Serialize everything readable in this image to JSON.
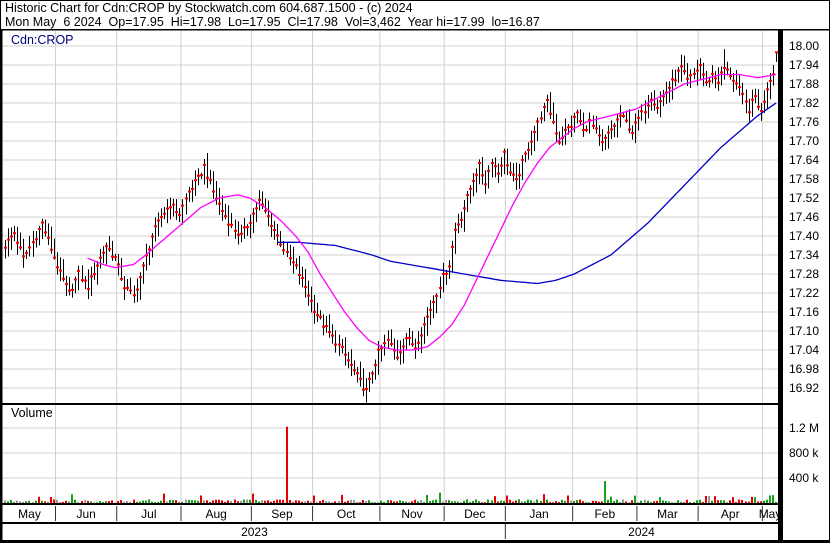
{
  "header": {
    "line1": "Historic Chart for Cdn:CROP by Stockwatch.com 604.687.1500 - (c) 2024",
    "line2": "Mon May  6 2024  Op=17.95  Hi=17.98  Lo=17.95  Cl=17.98  Vol=3,462  Year hi=17.99  lo=16.87"
  },
  "chart_data": {
    "type": "ohlc-with-volume",
    "symbol_label": "Cdn:CROP",
    "volume_label": "Volume",
    "quote": {
      "date": "Mon May 6 2024",
      "open": 17.95,
      "high": 17.98,
      "low": 17.95,
      "close": 17.98,
      "volume": 3462,
      "year_high": 17.99,
      "year_low": 16.87
    },
    "num_days": 253,
    "price_axis": {
      "ticks": [
        {
          "label": "18.00",
          "value": 18.0
        },
        {
          "label": "17.94",
          "value": 17.94
        },
        {
          "label": "17.88",
          "value": 17.88
        },
        {
          "label": "17.82",
          "value": 17.82
        },
        {
          "label": "17.76",
          "value": 17.76
        },
        {
          "label": "17.70",
          "value": 17.7
        },
        {
          "label": "17.64",
          "value": 17.64
        },
        {
          "label": "17.58",
          "value": 17.58
        },
        {
          "label": "17.52",
          "value": 17.52
        },
        {
          "label": "17.46",
          "value": 17.46
        },
        {
          "label": "17.40",
          "value": 17.4
        },
        {
          "label": "17.34",
          "value": 17.34
        },
        {
          "label": "17.28",
          "value": 17.28
        },
        {
          "label": "17.22",
          "value": 17.22
        },
        {
          "label": "17.16",
          "value": 17.16
        },
        {
          "label": "17.10",
          "value": 17.1
        },
        {
          "label": "17.04",
          "value": 17.04
        },
        {
          "label": "16.98",
          "value": 16.98
        },
        {
          "label": "16.92",
          "value": 16.92
        }
      ]
    },
    "volume_axis": {
      "ticks": [
        {
          "label": "1.2 M",
          "value": 1200000
        },
        {
          "label": "800 k",
          "value": 800000
        },
        {
          "label": "400 k",
          "value": 400000
        }
      ]
    },
    "months": [
      {
        "label": "May",
        "start": 0
      },
      {
        "label": "Jun",
        "start": 17
      },
      {
        "label": "Jul",
        "start": 37
      },
      {
        "label": "Aug",
        "start": 58
      },
      {
        "label": "Sep",
        "start": 81
      },
      {
        "label": "Oct",
        "start": 101
      },
      {
        "label": "Nov",
        "start": 123
      },
      {
        "label": "Dec",
        "start": 144
      },
      {
        "label": "Jan",
        "start": 164
      },
      {
        "label": "Feb",
        "start": 186
      },
      {
        "label": "Mar",
        "start": 207
      },
      {
        "label": "Apr",
        "start": 227
      },
      {
        "label": "May",
        "start": 248
      }
    ],
    "years": [
      {
        "label": "2023",
        "start": 0,
        "end": 164
      },
      {
        "label": "2024",
        "start": 164,
        "end": 253
      }
    ],
    "close_keyframes": [
      [
        0,
        17.37
      ],
      [
        3,
        17.41
      ],
      [
        6,
        17.33
      ],
      [
        9,
        17.38
      ],
      [
        12,
        17.44
      ],
      [
        15,
        17.36
      ],
      [
        18,
        17.28
      ],
      [
        21,
        17.22
      ],
      [
        24,
        17.28
      ],
      [
        27,
        17.24
      ],
      [
        30,
        17.31
      ],
      [
        33,
        17.37
      ],
      [
        36,
        17.33
      ],
      [
        39,
        17.24
      ],
      [
        42,
        17.21
      ],
      [
        45,
        17.3
      ],
      [
        48,
        17.4
      ],
      [
        51,
        17.46
      ],
      [
        54,
        17.5
      ],
      [
        57,
        17.47
      ],
      [
        60,
        17.54
      ],
      [
        63,
        17.58
      ],
      [
        65,
        17.62
      ],
      [
        68,
        17.54
      ],
      [
        71,
        17.48
      ],
      [
        74,
        17.43
      ],
      [
        77,
        17.4
      ],
      [
        80,
        17.45
      ],
      [
        83,
        17.51
      ],
      [
        86,
        17.46
      ],
      [
        89,
        17.4
      ],
      [
        92,
        17.34
      ],
      [
        95,
        17.3
      ],
      [
        98,
        17.24
      ],
      [
        101,
        17.17
      ],
      [
        104,
        17.12
      ],
      [
        107,
        17.08
      ],
      [
        110,
        17.04
      ],
      [
        113,
        16.99
      ],
      [
        116,
        16.94
      ],
      [
        118,
        16.91
      ],
      [
        120,
        16.97
      ],
      [
        122,
        17.03
      ],
      [
        125,
        17.07
      ],
      [
        128,
        17.02
      ],
      [
        131,
        17.08
      ],
      [
        134,
        17.05
      ],
      [
        137,
        17.12
      ],
      [
        139,
        17.17
      ],
      [
        141,
        17.22
      ],
      [
        143,
        17.27
      ],
      [
        145,
        17.31
      ],
      [
        147,
        17.42
      ],
      [
        149,
        17.46
      ],
      [
        151,
        17.52
      ],
      [
        153,
        17.58
      ],
      [
        155,
        17.62
      ],
      [
        157,
        17.57
      ],
      [
        159,
        17.64
      ],
      [
        161,
        17.6
      ],
      [
        163,
        17.66
      ],
      [
        165,
        17.6
      ],
      [
        167,
        17.57
      ],
      [
        169,
        17.63
      ],
      [
        171,
        17.68
      ],
      [
        173,
        17.73
      ],
      [
        175,
        17.78
      ],
      [
        177,
        17.82
      ],
      [
        179,
        17.76
      ],
      [
        181,
        17.7
      ],
      [
        183,
        17.73
      ],
      [
        185,
        17.75
      ],
      [
        187,
        17.79
      ],
      [
        189,
        17.73
      ],
      [
        191,
        17.76
      ],
      [
        193,
        17.73
      ],
      [
        195,
        17.69
      ],
      [
        197,
        17.72
      ],
      [
        199,
        17.75
      ],
      [
        201,
        17.78
      ],
      [
        203,
        17.76
      ],
      [
        205,
        17.73
      ],
      [
        207,
        17.77
      ],
      [
        209,
        17.8
      ],
      [
        211,
        17.84
      ],
      [
        213,
        17.81
      ],
      [
        215,
        17.84
      ],
      [
        217,
        17.87
      ],
      [
        219,
        17.9
      ],
      [
        221,
        17.93
      ],
      [
        223,
        17.89
      ],
      [
        225,
        17.91
      ],
      [
        227,
        17.94
      ],
      [
        229,
        17.88
      ],
      [
        231,
        17.91
      ],
      [
        233,
        17.89
      ],
      [
        235,
        17.93
      ],
      [
        237,
        17.91
      ],
      [
        239,
        17.88
      ],
      [
        241,
        17.84
      ],
      [
        243,
        17.8
      ],
      [
        245,
        17.84
      ],
      [
        247,
        17.79
      ],
      [
        249,
        17.87
      ],
      [
        251,
        17.92
      ],
      [
        252,
        17.98
      ]
    ],
    "bar_overrides": {
      "118": {
        "low": 16.87
      },
      "235": {
        "high": 17.99
      },
      "252": {
        "high": 17.98,
        "low": 17.95,
        "close": 17.98
      }
    },
    "ma_fast": {
      "name": "short-moving-average",
      "color": "#ff00ff",
      "points": [
        [
          27,
          17.33
        ],
        [
          32,
          17.31
        ],
        [
          36,
          17.3
        ],
        [
          42,
          17.31
        ],
        [
          46,
          17.34
        ],
        [
          52,
          17.39
        ],
        [
          58,
          17.44
        ],
        [
          64,
          17.49
        ],
        [
          70,
          17.52
        ],
        [
          76,
          17.53
        ],
        [
          80,
          17.52
        ],
        [
          85,
          17.49
        ],
        [
          90,
          17.45
        ],
        [
          95,
          17.4
        ],
        [
          99,
          17.35
        ],
        [
          103,
          17.28
        ],
        [
          107,
          17.22
        ],
        [
          111,
          17.16
        ],
        [
          115,
          17.11
        ],
        [
          119,
          17.07
        ],
        [
          123,
          17.05
        ],
        [
          128,
          17.04
        ],
        [
          133,
          17.04
        ],
        [
          138,
          17.05
        ],
        [
          142,
          17.08
        ],
        [
          146,
          17.12
        ],
        [
          150,
          17.18
        ],
        [
          154,
          17.26
        ],
        [
          158,
          17.34
        ],
        [
          162,
          17.42
        ],
        [
          166,
          17.5
        ],
        [
          170,
          17.57
        ],
        [
          174,
          17.63
        ],
        [
          178,
          17.68
        ],
        [
          182,
          17.71
        ],
        [
          186,
          17.74
        ],
        [
          190,
          17.76
        ],
        [
          194,
          17.77
        ],
        [
          198,
          17.78
        ],
        [
          202,
          17.79
        ],
        [
          206,
          17.8
        ],
        [
          210,
          17.82
        ],
        [
          214,
          17.84
        ],
        [
          218,
          17.86
        ],
        [
          222,
          17.88
        ],
        [
          226,
          17.89
        ],
        [
          230,
          17.9
        ],
        [
          234,
          17.91
        ],
        [
          240,
          17.91
        ],
        [
          246,
          17.9
        ],
        [
          252,
          17.91
        ]
      ]
    },
    "ma_slow": {
      "name": "long-moving-average",
      "color": "#0000c8",
      "points": [
        [
          89,
          17.38
        ],
        [
          96,
          17.38
        ],
        [
          102,
          17.375
        ],
        [
          108,
          17.37
        ],
        [
          114,
          17.355
        ],
        [
          120,
          17.34
        ],
        [
          126,
          17.32
        ],
        [
          132,
          17.31
        ],
        [
          138,
          17.3
        ],
        [
          144,
          17.29
        ],
        [
          150,
          17.28
        ],
        [
          156,
          17.27
        ],
        [
          162,
          17.26
        ],
        [
          168,
          17.255
        ],
        [
          174,
          17.25
        ],
        [
          180,
          17.26
        ],
        [
          186,
          17.28
        ],
        [
          192,
          17.31
        ],
        [
          198,
          17.34
        ],
        [
          204,
          17.39
        ],
        [
          210,
          17.44
        ],
        [
          216,
          17.5
        ],
        [
          222,
          17.56
        ],
        [
          228,
          17.62
        ],
        [
          234,
          17.68
        ],
        [
          240,
          17.73
        ],
        [
          246,
          17.78
        ],
        [
          252,
          17.82
        ]
      ]
    },
    "volume_spikes": [
      [
        11,
        100000,
        "red"
      ],
      [
        22,
        140000,
        "green"
      ],
      [
        52,
        150000,
        "red"
      ],
      [
        64,
        120000,
        "red"
      ],
      [
        81,
        150000,
        "red"
      ],
      [
        92,
        1220000,
        "red"
      ],
      [
        101,
        120000,
        "red"
      ],
      [
        110,
        130000,
        "red"
      ],
      [
        142,
        165000,
        "green"
      ],
      [
        160,
        110000,
        "red"
      ],
      [
        176,
        140000,
        "red"
      ],
      [
        184,
        120000,
        "red"
      ],
      [
        196,
        350000,
        "green"
      ],
      [
        214,
        95000,
        "green"
      ],
      [
        232,
        110000,
        "red"
      ],
      [
        244,
        100000,
        "red"
      ],
      [
        250,
        120000,
        "green"
      ]
    ],
    "colors": {
      "bar": "#000000",
      "close_tick": "#ff0000",
      "volume_up": "#18a018",
      "volume_down": "#e60000",
      "volume_flat": "#999999",
      "grid": "#d0d0d0",
      "border": "#000000",
      "symbol_text": "#000080",
      "axis_text": "#000000"
    }
  }
}
